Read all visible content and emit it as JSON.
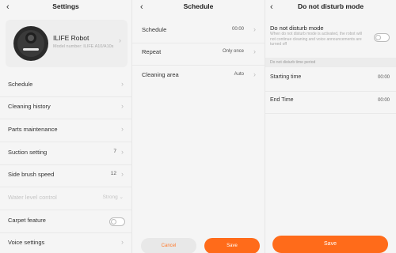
{
  "settings": {
    "back_icon": "chevron-left-icon",
    "title": "Settings",
    "robot": {
      "name": "ILIFE Robot",
      "model": "Model number: ILIFE A10/A10s"
    },
    "items": [
      {
        "label": "Schedule"
      },
      {
        "label": "Cleaning history"
      },
      {
        "label": "Parts maintenance"
      },
      {
        "label": "Suction setting",
        "value": "7"
      },
      {
        "label": "Side brush speed",
        "value": "12"
      },
      {
        "label": "Water level control",
        "value": "Strong",
        "disabled": true
      },
      {
        "label": "Carpet feature",
        "toggle": "off"
      },
      {
        "label": "Voice settings"
      }
    ]
  },
  "schedule": {
    "title": "Schedule",
    "rows": [
      {
        "label": "Schedule",
        "value": "00:00"
      },
      {
        "label": "Repeat",
        "value": "Only once"
      },
      {
        "label": "Cleaning area",
        "value": "Auto"
      }
    ],
    "cancel_label": "Cancel",
    "save_label": "Save"
  },
  "dnd": {
    "title": "Do not disturb mode",
    "mode_label": "Do not disturb mode",
    "mode_toggle": "off",
    "description": "When do not disturb mode is activated, the robot will not continue cleaning and voice announcements are turned off",
    "section_label": "Do not disturb time period",
    "rows": [
      {
        "label": "Starting time",
        "value": "00:00"
      },
      {
        "label": "End Time",
        "value": "00:00"
      }
    ],
    "save_label": "Save"
  },
  "colors": {
    "accent": "#ff6b1a",
    "background": "#f5f5f5",
    "card": "#eeeeee"
  }
}
